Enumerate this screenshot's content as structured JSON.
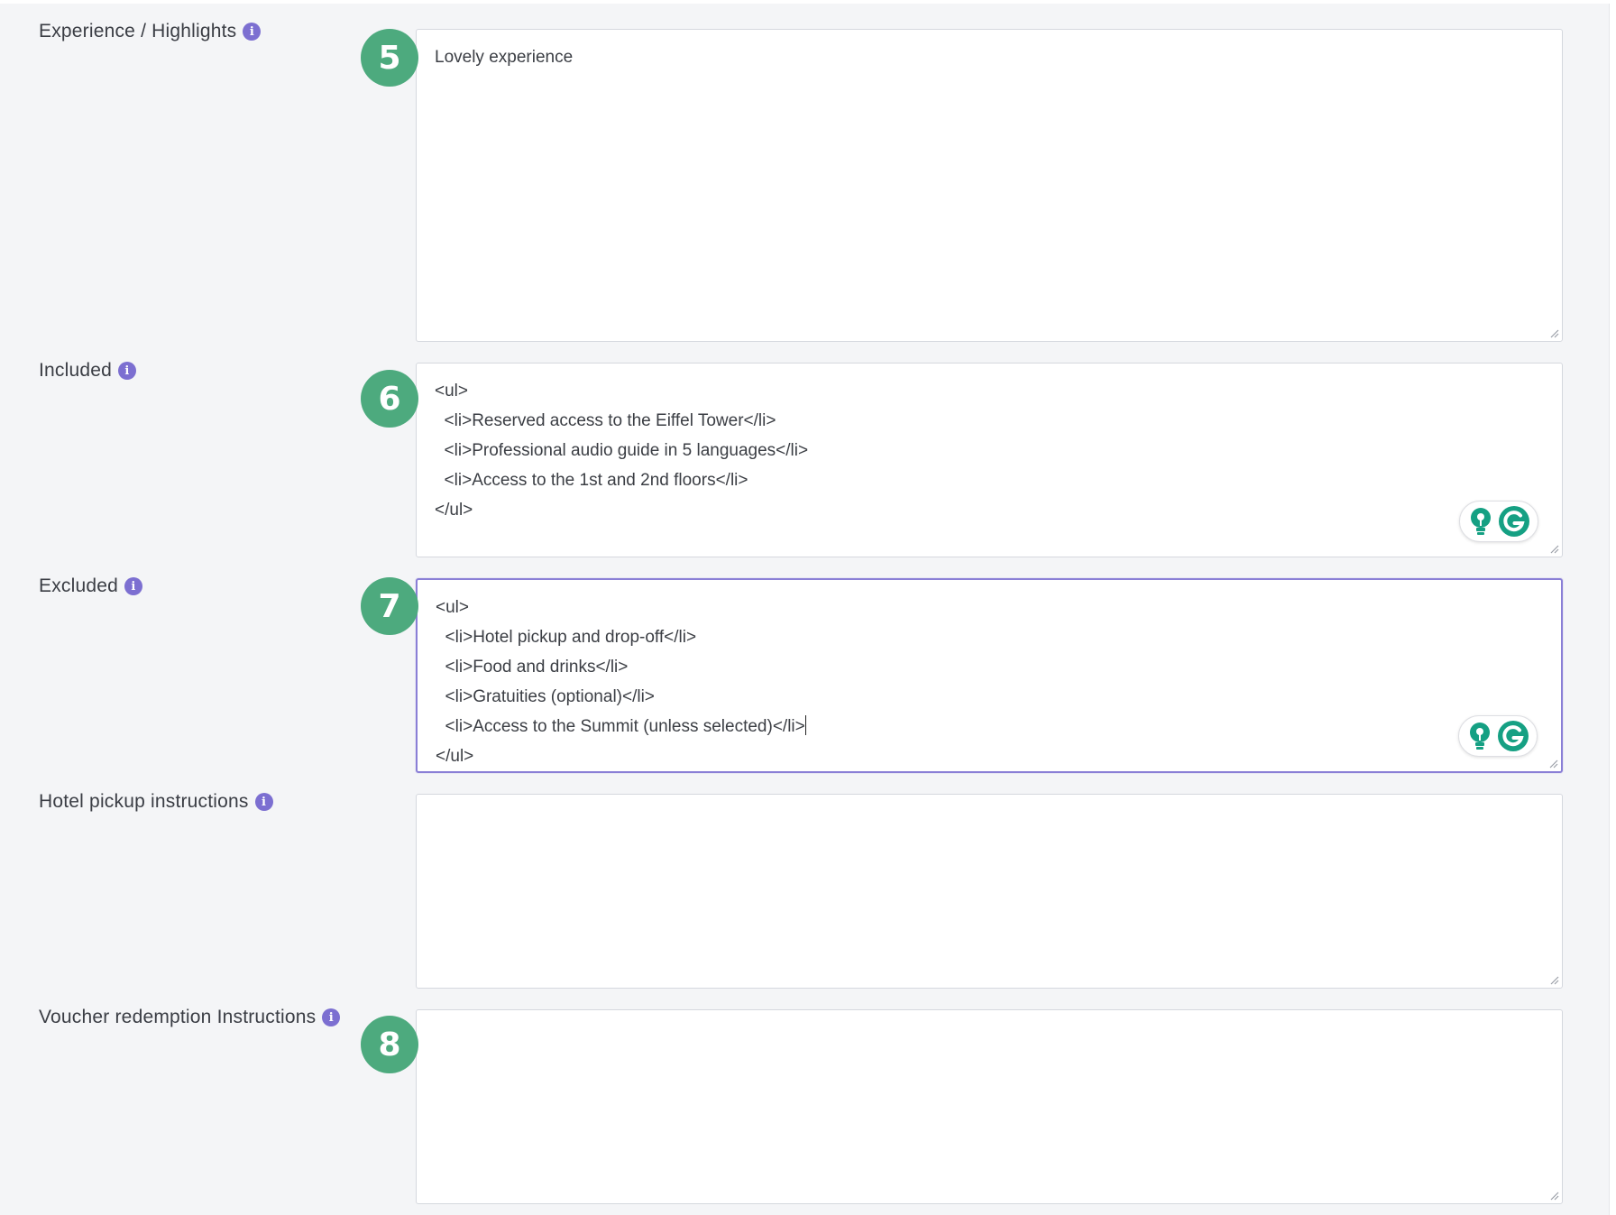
{
  "fields": [
    {
      "label": "Experience / Highlights",
      "badge": "5",
      "value": "Lovely experience",
      "focused": false
    },
    {
      "label": "Included",
      "badge": "6",
      "value": "<ul>\n  <li>Reserved access to the Eiffel Tower</li>\n  <li>Professional audio guide in 5 languages</li>\n  <li>Access to the 1st and 2nd floors</li>\n</ul>",
      "focused": false
    },
    {
      "label": "Excluded",
      "badge": "7",
      "value_before_caret": "<ul>\n  <li>Hotel pickup and drop-off</li>\n  <li>Food and drinks</li>\n  <li>Gratuities (optional)</li>\n  <li>Access to the Summit (unless selected)</li>",
      "value_after_caret": "\n</ul>",
      "focused": true
    },
    {
      "label": "Hotel pickup instructions",
      "value": ""
    },
    {
      "label": "Voucher redemption Instructions",
      "badge": "8",
      "value": ""
    }
  ],
  "info_icon_glyph": "i",
  "icons": {
    "info": "info-icon",
    "assistant_bulb": "lightbulb-icon",
    "assistant_g": "grammar-assistant-icon",
    "resize": "resize-handle-icon"
  },
  "colors": {
    "badge": "#4daa7e",
    "info_icon": "#7c6fd1",
    "focus_border": "#8a7fd6",
    "assistant": "#15a083"
  }
}
